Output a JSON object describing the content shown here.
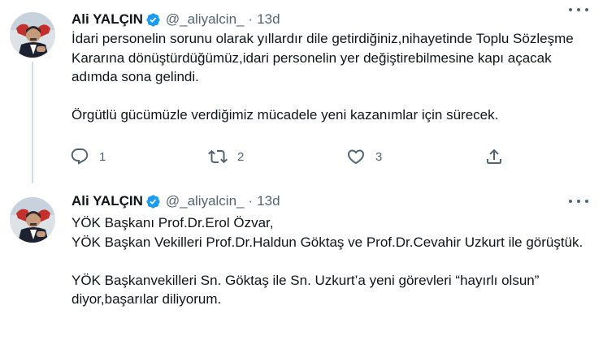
{
  "tweets": [
    {
      "author": {
        "name": "Ali YALÇIN",
        "handle": "@_aliyalcin_",
        "verified": true
      },
      "separator": "·",
      "time": "13d",
      "paragraphs": [
        "İdari personelin sorunu olarak yıllardır dile getirdiğiniz,nihayetinde Toplu Sözleşme Kararına dönüştürdüğümüz,idari personelin yer değiştirebilmesine kapı açacak adımda sona gelindi.",
        "Örgütlü gücümüzle verdiğimiz mücadele yeni kazanımlar için sürecek."
      ],
      "actions": {
        "replies": "1",
        "retweets": "2",
        "likes": "3"
      }
    },
    {
      "author": {
        "name": "Ali YALÇIN",
        "handle": "@_aliyalcin_",
        "verified": true
      },
      "separator": "·",
      "time": "13d",
      "paragraphs": [
        "YÖK Başkanı Prof.Dr.Erol Özvar,\nYÖK Başkan Vekilleri Prof.Dr.Haldun Göktaş ve Prof.Dr.Cevahir Uzkurt ile görüştük.",
        "YÖK Başkanvekilleri Sn. Göktaş ile Sn. Uzkurt’a yeni görevleri “hayırlı olsun” diyor,başarılar diliyorum."
      ]
    }
  ],
  "icons": {
    "reply": "reply-icon",
    "retweet": "retweet-icon",
    "like": "heart-icon",
    "share": "share-icon",
    "verified": "verified-badge-icon",
    "more": "more-icon"
  },
  "colors": {
    "verified": "#1d9bf0",
    "secondary_text": "#536471",
    "thread_line": "#cfd9de"
  }
}
